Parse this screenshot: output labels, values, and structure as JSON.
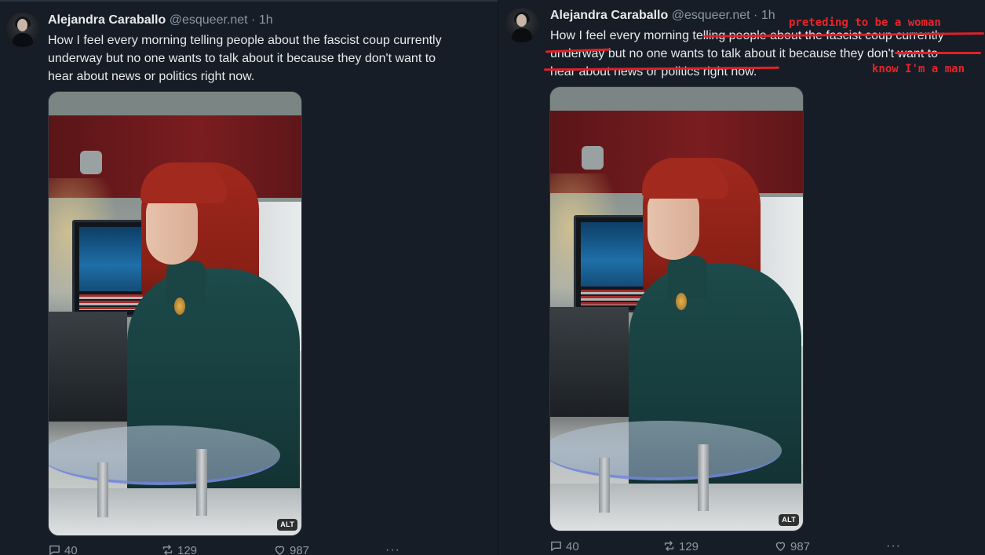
{
  "left_tweet": {
    "author_name": "Alejandra Caraballo",
    "handle_time": "@esqueer.net · 1h",
    "text_line1": "How I feel every morning telling people about the fascist coup currently",
    "text_line2": "underway but no one wants to talk about it because they don't want to",
    "text_line3": "hear about news or politics right now.",
    "alt_badge": "ALT",
    "replies": "40",
    "reposts": "129",
    "likes": "987",
    "more": "···"
  },
  "right_tweet": {
    "author_name": "Alejandra Caraballo",
    "handle_time": "@esqueer.net · 1h",
    "line1_start": "How I feel every morning ",
    "line1_struck": "telling people about the fascist coup currently",
    "line2_struck": "underway",
    "line2_mid": " but no one wants to talk about it because they ",
    "line2_struck_end": "don't want to",
    "line3_struck": "hear about news or politics right now.",
    "alt_badge": "ALT",
    "replies": "40",
    "reposts": "129",
    "likes": "987",
    "more": "···",
    "annotation_top": "preteding to be a woman",
    "annotation_bottom": "know I'm a man",
    "annotation_color": "#e8232a"
  },
  "icons": {
    "reply": "reply-icon",
    "repost": "repost-icon",
    "like": "heart-icon",
    "more": "more-icon"
  },
  "colors": {
    "background": "#161d26",
    "text": "#e7e9ea",
    "muted": "#8b98a5",
    "annotation": "#e8232a"
  }
}
